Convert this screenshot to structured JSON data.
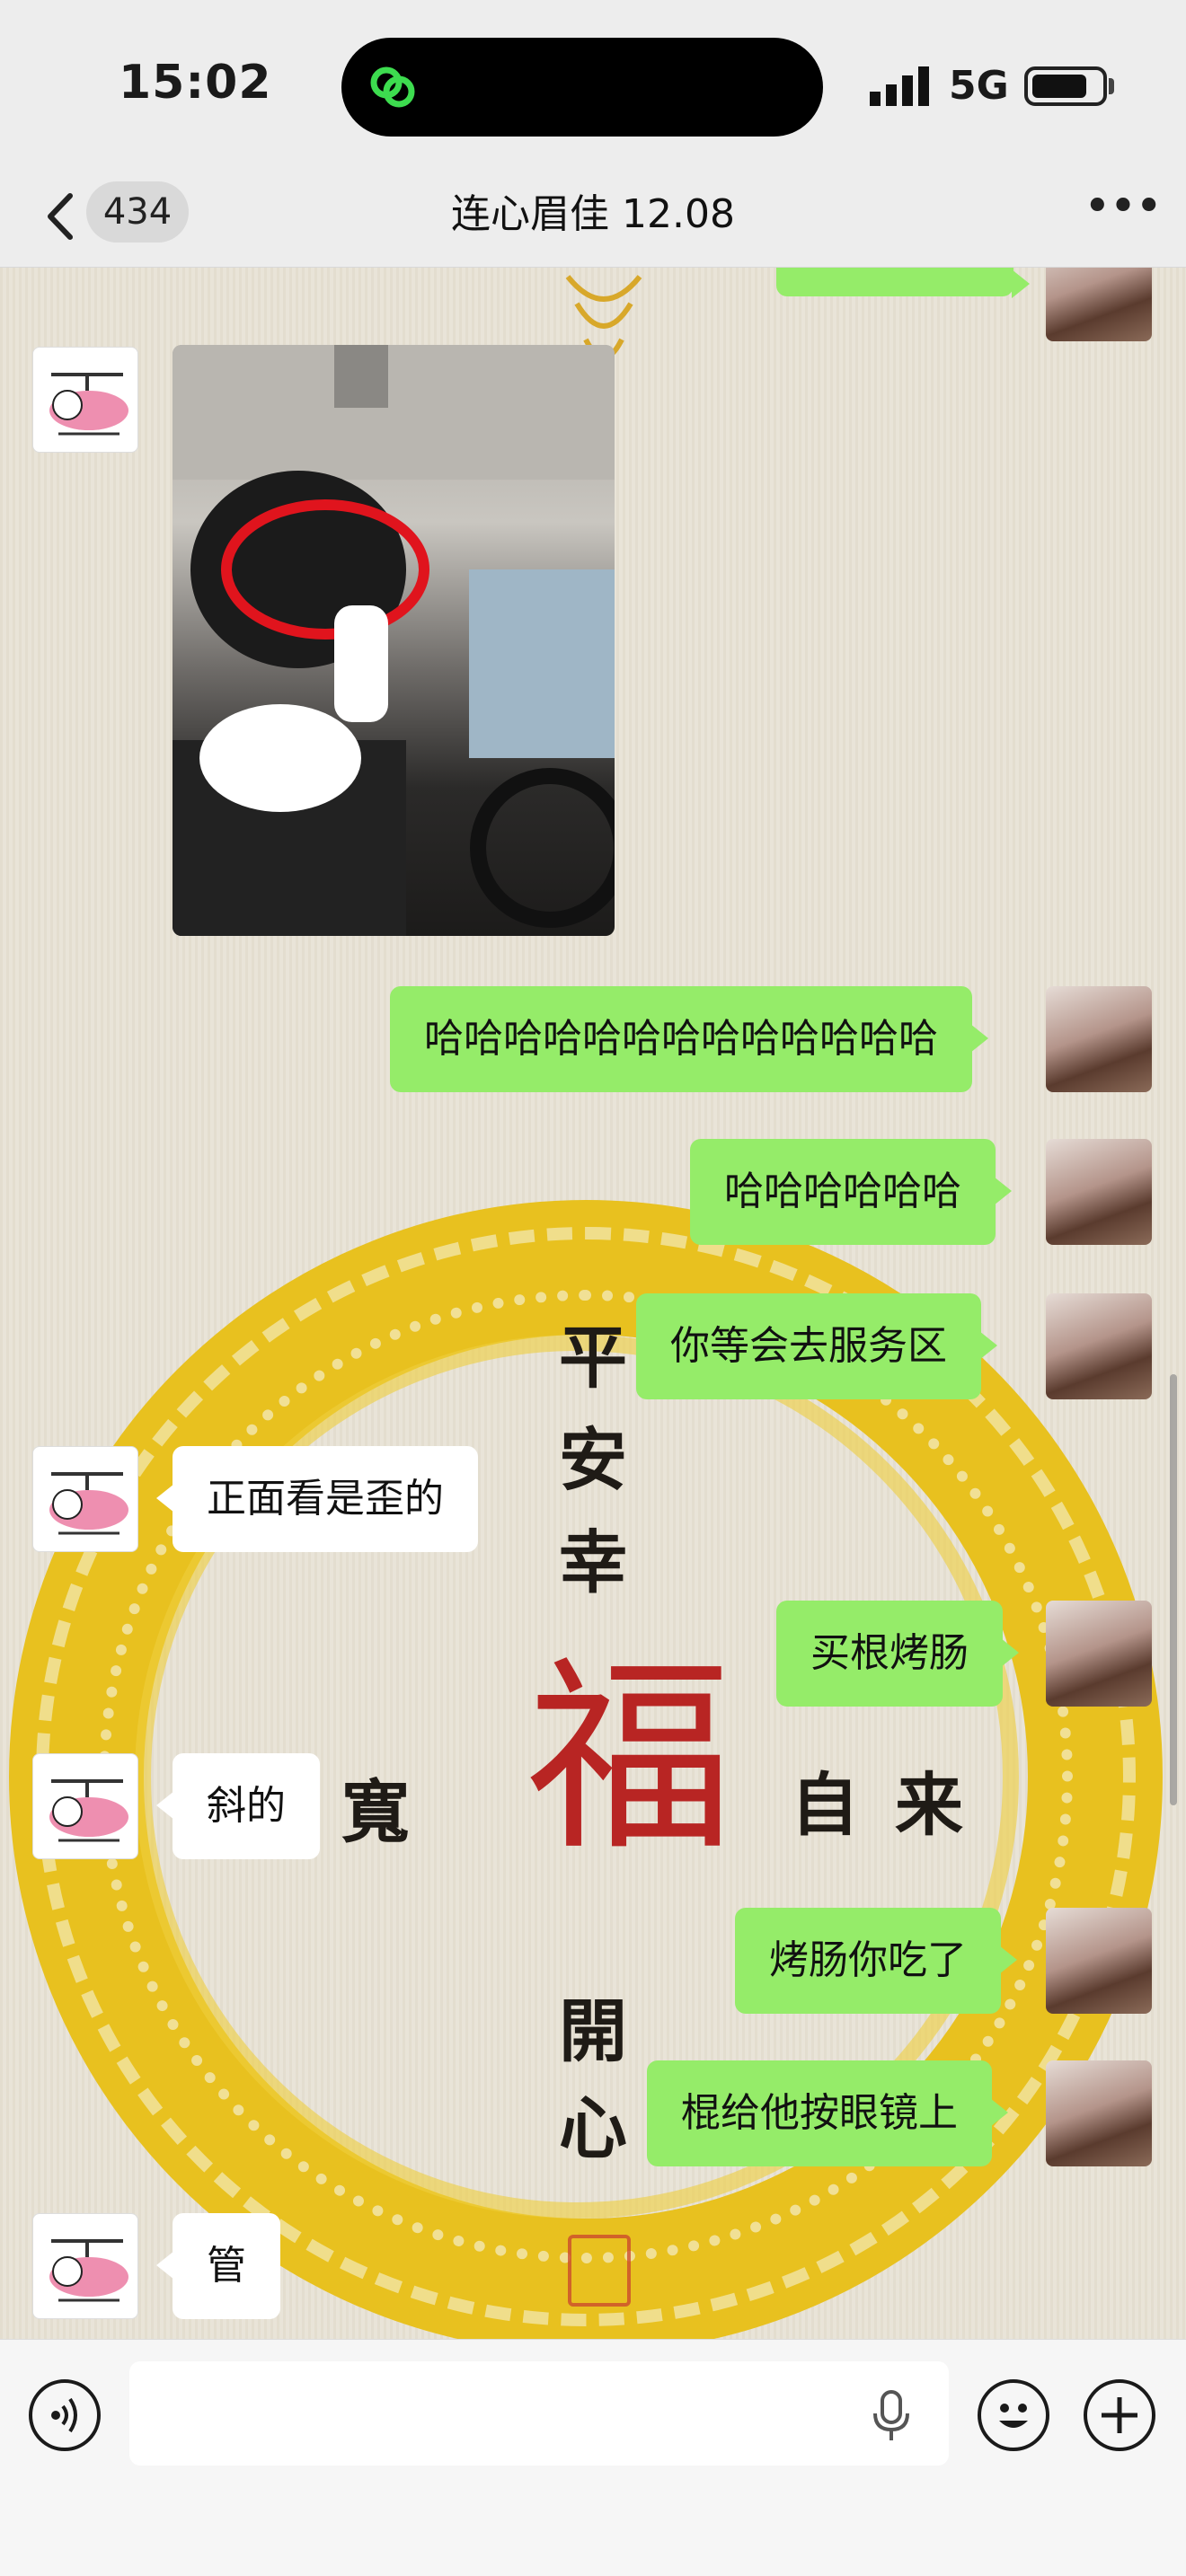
{
  "status_bar": {
    "time": "15:02",
    "network": "5G",
    "icons": [
      "link-icon",
      "signal-icon",
      "battery-icon"
    ]
  },
  "nav": {
    "back_icon": "chevron-left-icon",
    "unread_count": "434",
    "title": "连心眉佳 12.08",
    "more_icon": "more-dots-icon"
  },
  "messages": [
    {
      "from": "other",
      "type": "image",
      "avatar": "hello-kitty-helicopter-avatar"
    },
    {
      "from": "me",
      "type": "text",
      "text": "哈哈哈哈哈哈哈哈哈哈哈哈哈"
    },
    {
      "from": "me",
      "type": "text",
      "text": "哈哈哈哈哈哈"
    },
    {
      "from": "me",
      "type": "text",
      "text": "你等会去服务区"
    },
    {
      "from": "other",
      "type": "text",
      "text": "正面看是歪的"
    },
    {
      "from": "me",
      "type": "text",
      "text": "买根烤肠"
    },
    {
      "from": "other",
      "type": "text",
      "text": "斜的"
    },
    {
      "from": "me",
      "type": "text",
      "text": "烤肠你吃了"
    },
    {
      "from": "me",
      "type": "text",
      "text": "棍给他按眼镜上"
    },
    {
      "from": "other",
      "type": "text",
      "text": "管"
    }
  ],
  "wallpaper": {
    "characters": [
      "平",
      "安",
      "幸",
      "福",
      "開",
      "心",
      "寬",
      "自",
      "来"
    ],
    "colors": {
      "ring": "#e8c11f",
      "fu": "#b82523"
    }
  },
  "input_bar": {
    "voice_icon": "voice-icon",
    "mic_icon": "microphone-icon",
    "emoji_icon": "emoji-icon",
    "add_icon": "plus-icon"
  },
  "colors": {
    "my_bubble": "#95ec69",
    "other_bubble": "#ffffff",
    "bar_bg": "#ededed"
  }
}
